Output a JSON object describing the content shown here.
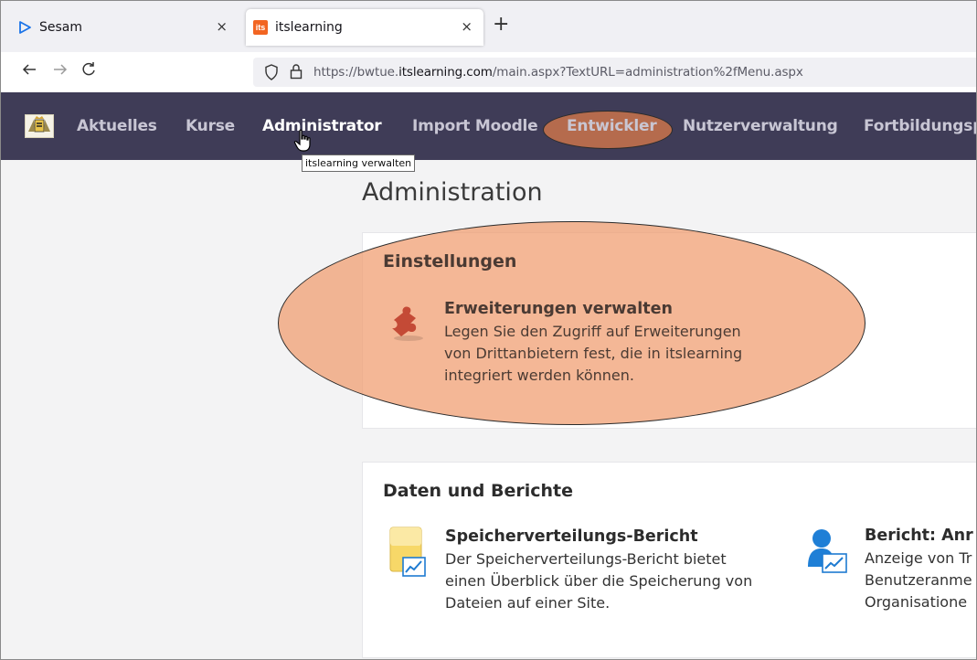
{
  "browser": {
    "tabs": [
      {
        "label": "Sesam",
        "icon": "play-triangle-icon",
        "active": false
      },
      {
        "label": "itslearning",
        "icon": "itslearning-logo-icon",
        "logo_text": "its",
        "active": true
      }
    ],
    "new_tab_symbol": "+",
    "close_symbol": "×",
    "url_prefix": "https://bwtue.",
    "url_domain": "itslearning.com",
    "url_path": "/main.aspx?TextURL=administration%2fMenu.aspx",
    "accent_color": "#1a73e8"
  },
  "site_nav": {
    "items": [
      {
        "label": "Aktuelles"
      },
      {
        "label": "Kurse"
      },
      {
        "label": "Administrator",
        "active": true
      },
      {
        "label": "Import Moodle"
      },
      {
        "label": "Entwickler",
        "highlighted": true
      },
      {
        "label": "Nutzerverwaltung"
      },
      {
        "label": "Fortbildungsp"
      }
    ],
    "tooltip": "itslearning verwalten",
    "background_color": "#3f3c57"
  },
  "page": {
    "title": "Administration",
    "sections": [
      {
        "title": "Einstellungen",
        "items": [
          {
            "icon": "puzzle-piece-icon",
            "title": "Erweiterungen verwalten",
            "description_lines": [
              "Legen Sie den Zugriff auf Erweiterungen",
              "von Drittanbietern fest, die in itslearning",
              "integriert werden können."
            ]
          }
        ]
      },
      {
        "title": "Daten und Berichte",
        "items": [
          {
            "icon": "folder-chart-icon",
            "title": "Speicherverteilungs-Bericht",
            "description_lines": [
              "Der Speicherverteilungs-Bericht bietet",
              "einen Überblick über die Speicherung von",
              "Dateien auf einer Site."
            ]
          },
          {
            "icon": "user-chart-icon",
            "title": "Bericht: Anr",
            "description_lines": [
              "Anzeige von Tr",
              "Benutzeranme",
              "Organisatione"
            ]
          }
        ]
      }
    ]
  },
  "highlight_color": "#f09b6e"
}
